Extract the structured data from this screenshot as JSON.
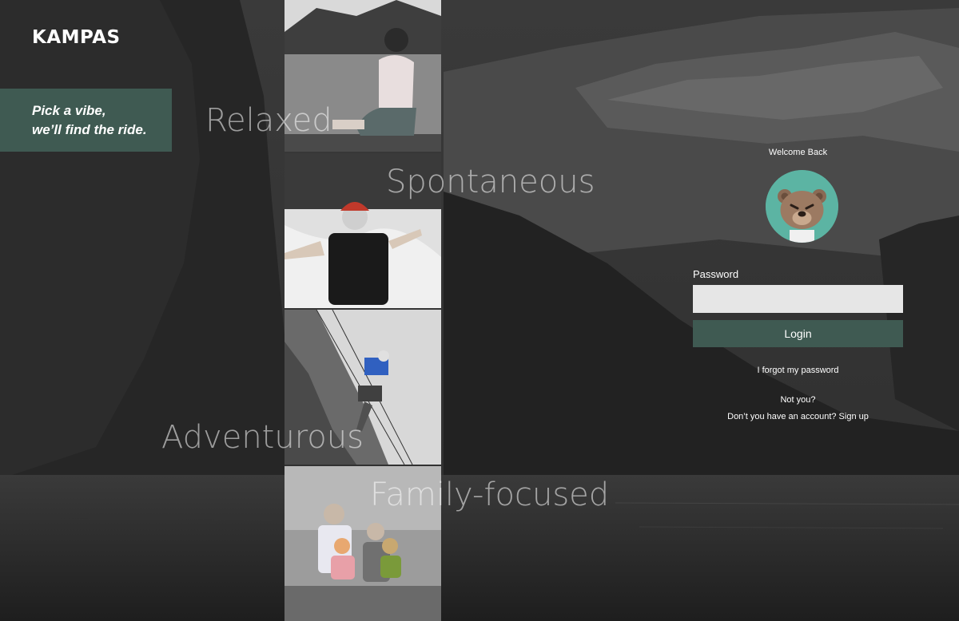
{
  "brand": {
    "name": "KAMPAS"
  },
  "tagline": {
    "line1": "Pick a vibe,",
    "line2": "we’ll find the ride."
  },
  "vibes": [
    {
      "label": "Relaxed"
    },
    {
      "label": "Spontaneous"
    },
    {
      "label": "Adventurous"
    },
    {
      "label": "Family-focused"
    }
  ],
  "login": {
    "welcome": "Welcome Back",
    "avatar": "bear-avatar",
    "password_label": "Password",
    "password_value": "",
    "login_label": "Login",
    "forgot_label": "I forgot my password",
    "not_you_label": "Not you?",
    "signup_label": "Don’t you have an account? Sign up"
  },
  "colors": {
    "accent": "#3f5a52",
    "avatar_bg": "#5cb4a3",
    "input_bg": "#e6e6e6"
  },
  "icons": {
    "avatar": "bear-avatar"
  }
}
